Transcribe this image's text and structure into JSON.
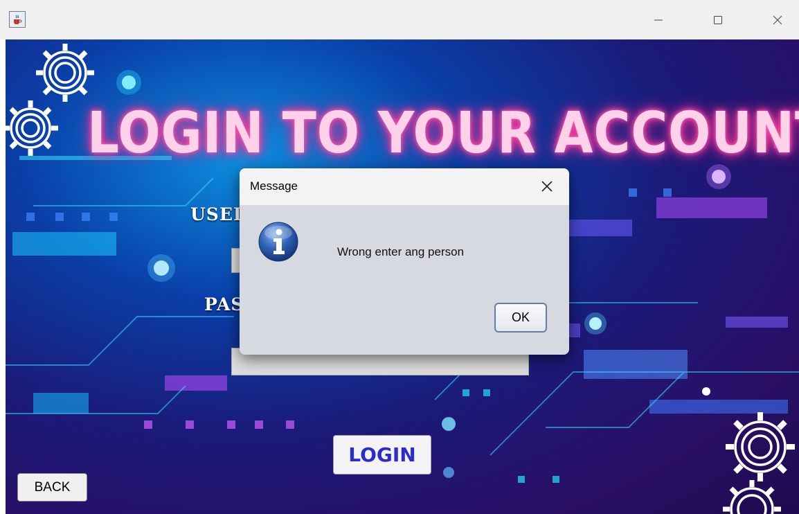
{
  "window": {
    "app_icon": "java-app-icon",
    "minimize_icon": "minimize-icon",
    "maximize_icon": "maximize-icon",
    "close_icon": "close-icon"
  },
  "login": {
    "headline": "LOGIN TO YOUR ACCOUNT",
    "username_label": "USEI",
    "password_label": "PAS",
    "login_button": "LOGIN",
    "back_button": "BACK"
  },
  "dialog": {
    "title": "Message",
    "message": "Wrong enter ang person",
    "ok_button": "OK",
    "icon": "info-icon"
  },
  "colors": {
    "headline_glow": "#ff3d9e",
    "login_text": "#2b2bd0",
    "dialog_body": "#d6d9e0"
  }
}
